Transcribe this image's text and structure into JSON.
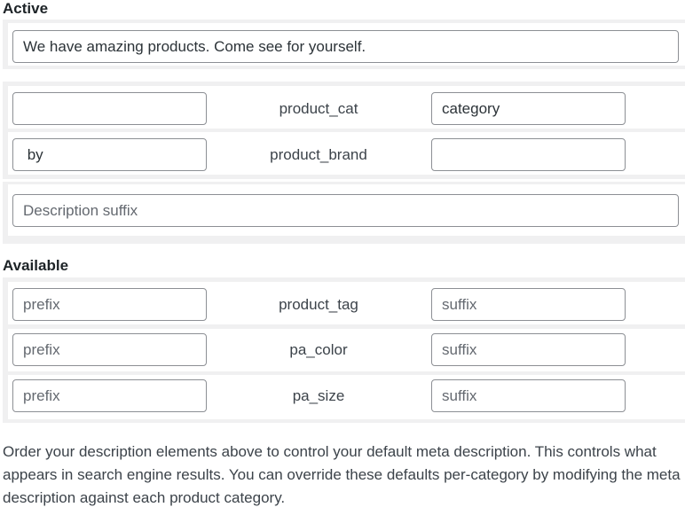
{
  "active": {
    "heading": "Active",
    "description_text": "We have amazing products. Come see for yourself.",
    "rows": [
      {
        "prefix": "",
        "taxonomy": "product_cat",
        "suffix": "category"
      },
      {
        "prefix": " by",
        "taxonomy": "product_brand",
        "suffix": ""
      }
    ],
    "suffix_placeholder": "Description suffix"
  },
  "available": {
    "heading": "Available",
    "rows": [
      {
        "prefix_placeholder": "prefix",
        "taxonomy": "product_tag",
        "suffix_placeholder": "suffix"
      },
      {
        "prefix_placeholder": "prefix",
        "taxonomy": "pa_color",
        "suffix_placeholder": "suffix"
      },
      {
        "prefix_placeholder": "prefix",
        "taxonomy": "pa_size",
        "suffix_placeholder": "suffix"
      }
    ]
  },
  "help_text": "Order your description elements above to control your default meta description. This controls what appears in search engine results. You can override these defaults per-category by modifying the meta description against each product category."
}
